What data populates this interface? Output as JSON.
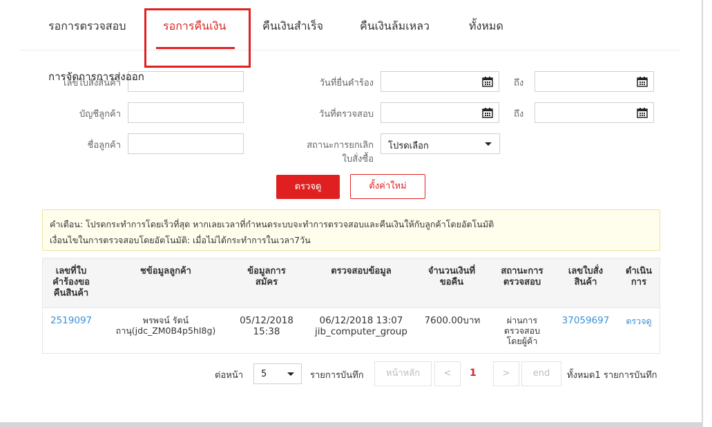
{
  "tabs": [
    {
      "label": "รอการตรวจสอบ",
      "active": false
    },
    {
      "label": "รอการคืนเงิน",
      "active": true
    },
    {
      "label": "คืนเงินสำเร็จ",
      "active": false
    },
    {
      "label": "คืนเงินล้มเหลว",
      "active": false
    },
    {
      "label": "ทั้งหมด",
      "active": false
    }
  ],
  "section_title": "การจัดการการส่งออก",
  "form": {
    "order_no_label": "เลขใบสั่งสินค้า",
    "customer_account_label": "บัญชีลูกค้า",
    "customer_name_label": "ชื่อลูกค้า",
    "request_date_label": "วันที่ยื่นคำร้อง",
    "check_date_label": "วันที่ตรวจสอบ",
    "to_label": "ถึง",
    "cancel_status_label_1": "สถานะการยกเลิก",
    "cancel_status_label_2": "ใบสั่งซื้อ",
    "cancel_status_value": "โปรดเลือก"
  },
  "buttons": {
    "search": "ตรวจดู",
    "reset": "ตั้งค่าใหม่"
  },
  "notice": {
    "line1": "คำเตือน: โปรดกระทำการโดยเร็วที่สุด หากเลยเวลาที่กำหนดระบบจะทำการตรวจสอบและคืนเงินให้กับลูกค้าโดยอัตโนมัติ",
    "line2": "เงื่อนไขในการตรวจสอบโดยอัตโนมัติ: เมื่อไม่ได้กระทำการในเวลา7วัน"
  },
  "table": {
    "headers": {
      "request_no": [
        "เลขที่ใบ",
        "คำร้องขอ",
        "คืนสินค้า"
      ],
      "customer_info": [
        "ชข้อมูลลูกค้า"
      ],
      "apply_info": [
        "ข้อมูลการ",
        "สมัคร"
      ],
      "check_info": [
        "ตรวจสอบข้อมูล"
      ],
      "refund_amount": [
        "จำนวนเงินที่",
        "ขอคืน"
      ],
      "check_status": [
        "สถานะการ",
        "ตรวจสอบ"
      ],
      "order_no": [
        "เลขใบสั่ง",
        "สินค้า"
      ],
      "action": [
        "ดำเนิน",
        "การ"
      ]
    },
    "rows": [
      {
        "request_no": "2519097",
        "customer_1": "พรพจน์ รัตน์",
        "customer_2": "ถานุ(jdc_ZM0B4p5hI8g)",
        "apply_1": "05/12/2018",
        "apply_2": "15:38",
        "check_1": "06/12/2018 13:07",
        "check_2": "jib_computer_group",
        "amount": "7600.00บาท",
        "status_1": "ผ่านการ",
        "status_2": "ตรวจสอบ",
        "status_3": "โดยผู้ค้า",
        "order_no": "37059697",
        "action": "ตรวจดู"
      }
    ]
  },
  "pagination": {
    "per_page_label": "ต่อหน้า",
    "per_page_value": "5",
    "records_label": "รายการบันทึก",
    "first": "หน้าหลัก",
    "prev": "<",
    "current": "1",
    "next": ">",
    "last": "end",
    "total": "ทั้งหมด1 รายการบันทึก"
  },
  "colors": {
    "accent": "#e02020",
    "link": "#3a8fd6",
    "notice_bg": "#fffdeb"
  }
}
